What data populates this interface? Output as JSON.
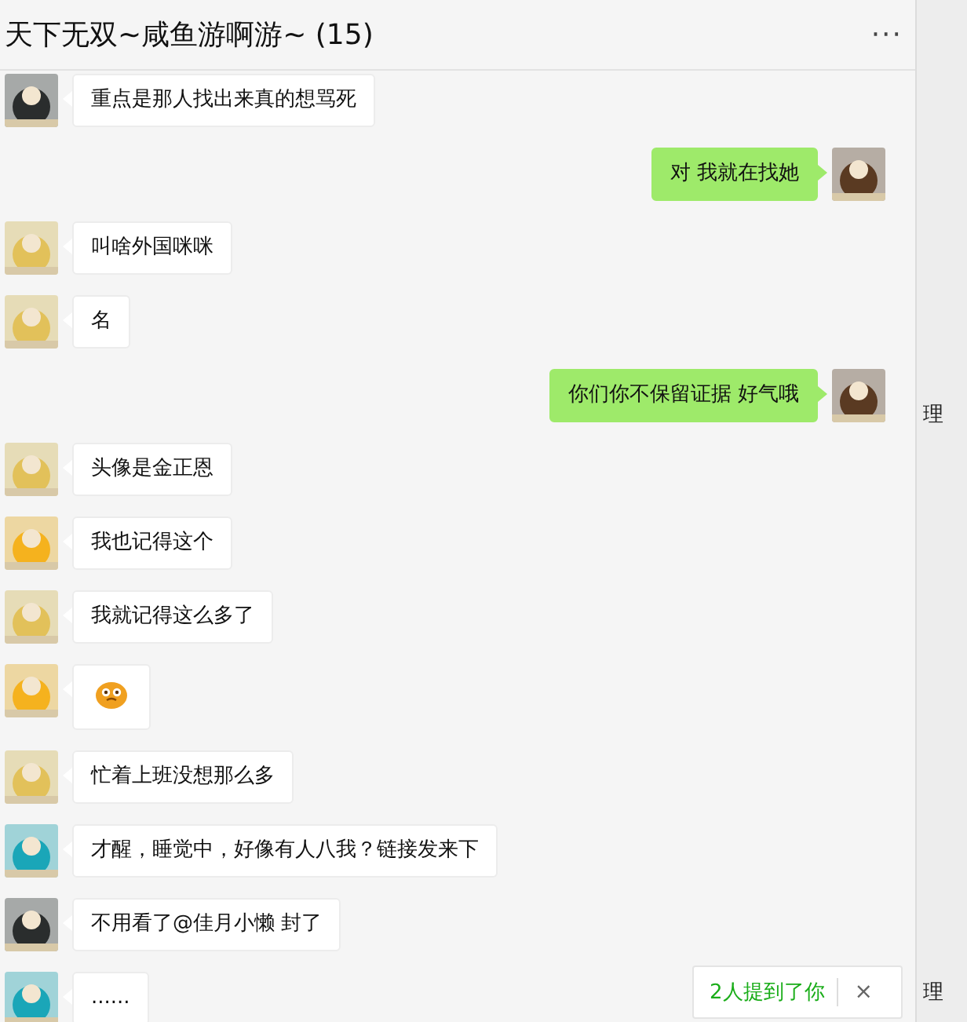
{
  "chat": {
    "title": "天下无双~咸鱼游啊游~ (15)",
    "menu": "···"
  },
  "messages": [
    {
      "outgoing": false,
      "color": "#2a2d2d",
      "kind": "text",
      "text": "重点是那人找出来真的想骂死"
    },
    {
      "outgoing": true,
      "color": "#5a3a22",
      "kind": "text",
      "text": "对 我就在找她"
    },
    {
      "outgoing": false,
      "color": "#e2c15a",
      "kind": "text",
      "text": "叫啥外国咪咪"
    },
    {
      "outgoing": false,
      "color": "#e2c15a",
      "kind": "text",
      "text": "名"
    },
    {
      "outgoing": true,
      "color": "#5a3a22",
      "kind": "text",
      "text": "你们你不保留证据 好气哦"
    },
    {
      "outgoing": false,
      "color": "#e2c15a",
      "kind": "text",
      "text": "头像是金正恩"
    },
    {
      "outgoing": false,
      "color": "#f5b21e",
      "kind": "text",
      "text": "我也记得这个"
    },
    {
      "outgoing": false,
      "color": "#e2c15a",
      "kind": "text",
      "text": "我就记得这么多了"
    },
    {
      "outgoing": false,
      "color": "#f5b21e",
      "kind": "sticker"
    },
    {
      "outgoing": false,
      "color": "#e2c15a",
      "kind": "text",
      "text": "忙着上班没想那么多"
    },
    {
      "outgoing": false,
      "color": "#1aa6b8",
      "kind": "text",
      "text": "才醒，睡觉中，好像有人八我？链接发来下"
    },
    {
      "outgoing": false,
      "color": "#2a2d2d",
      "kind": "text",
      "text": "不用看了@佳月小懒 封了"
    },
    {
      "outgoing": false,
      "color": "#1aa6b8",
      "kind": "text",
      "text": "......"
    }
  ],
  "mention_toast": {
    "text": "2人提到了你",
    "close": "×"
  },
  "side_fragments": [
    "理",
    "理"
  ]
}
